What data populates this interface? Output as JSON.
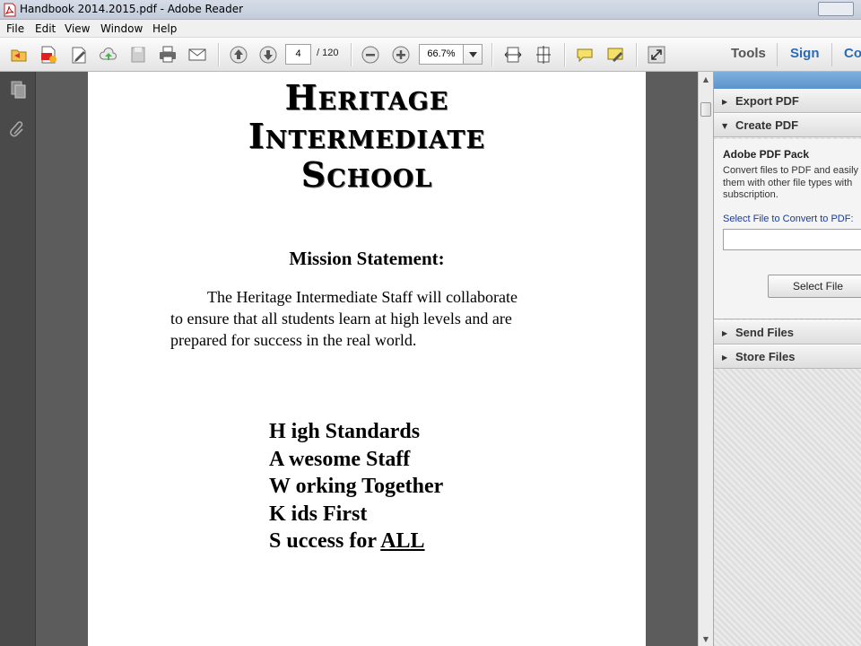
{
  "window": {
    "title": "Handbook 2014.2015.pdf - Adobe Reader"
  },
  "menu": {
    "items": [
      "File",
      "Edit",
      "View",
      "Window",
      "Help"
    ]
  },
  "toolbar": {
    "page_current": "4",
    "page_total": "/ 120",
    "zoom": "66.7%",
    "tools_label": "Tools",
    "sign_label": "Sign",
    "comment_label": "Co"
  },
  "document": {
    "school_lines": [
      "Heritage",
      "Intermediate",
      "School"
    ],
    "mission_title": "Mission Statement:",
    "mission_lines": [
      "The Heritage Intermediate Staff will collaborate",
      "to ensure that all students learn at high levels and are",
      "prepared for success in the real world."
    ],
    "acrostic": [
      "H igh Standards",
      "A wesome Staff",
      "W orking Together",
      "K ids First"
    ],
    "acrostic_last_prefix": "S uccess for ",
    "acrostic_last_underlined": "ALL"
  },
  "right_pane": {
    "export_pdf": "Export PDF",
    "create_pdf": "Create PDF",
    "pack_title": "Adobe PDF Pack",
    "pack_desc": [
      "Convert files to PDF and easily",
      "them with other file types with",
      "subscription."
    ],
    "select_label": "Select File to Convert to PDF:",
    "select_button": "Select File",
    "send_files": "Send Files",
    "store_files": "Store Files"
  },
  "colors": {
    "accent_blue": "#2a6bb5",
    "pane_strip": "#5b93cc"
  }
}
